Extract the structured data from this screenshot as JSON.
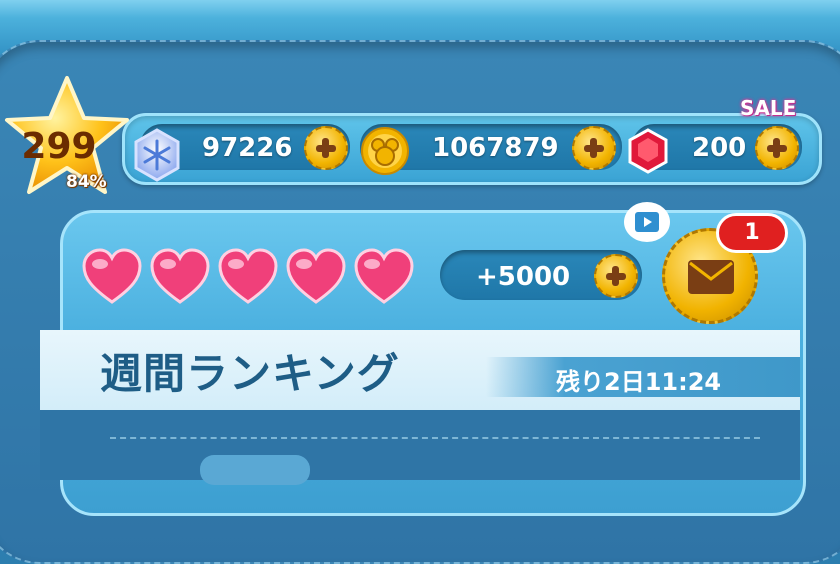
{
  "player": {
    "level": "299",
    "progress_label": "84%"
  },
  "currencies": {
    "gems": {
      "value": "97226",
      "icon": "snowflake-gem-icon"
    },
    "coins": {
      "value": "1067879",
      "icon": "coin-icon"
    },
    "rubies": {
      "value": "200",
      "icon": "ruby-icon",
      "sale_label": "SALE"
    }
  },
  "hearts": {
    "count": 5,
    "bonus": "+5000"
  },
  "mail": {
    "badge": "1"
  },
  "ranking": {
    "title": "週間ランキング",
    "time_left": "残り2日11:24"
  },
  "colors": {
    "heart": "#f0407a",
    "coin": "#f2b400",
    "ruby": "#e0193a",
    "badge": "#e02020"
  }
}
